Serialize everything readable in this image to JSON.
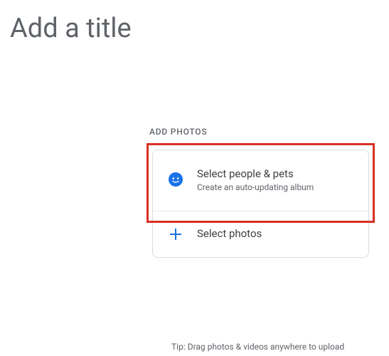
{
  "title": {
    "placeholder": "Add a title",
    "value": ""
  },
  "section": {
    "label": "ADD PHOTOS"
  },
  "options": {
    "people_pets": {
      "title": "Select people & pets",
      "subtitle": "Create an auto-updating album",
      "icon": "face-icon"
    },
    "select_photos": {
      "title": "Select photos",
      "icon": "plus-icon"
    }
  },
  "tip": "Tip: Drag photos & videos anywhere to upload"
}
